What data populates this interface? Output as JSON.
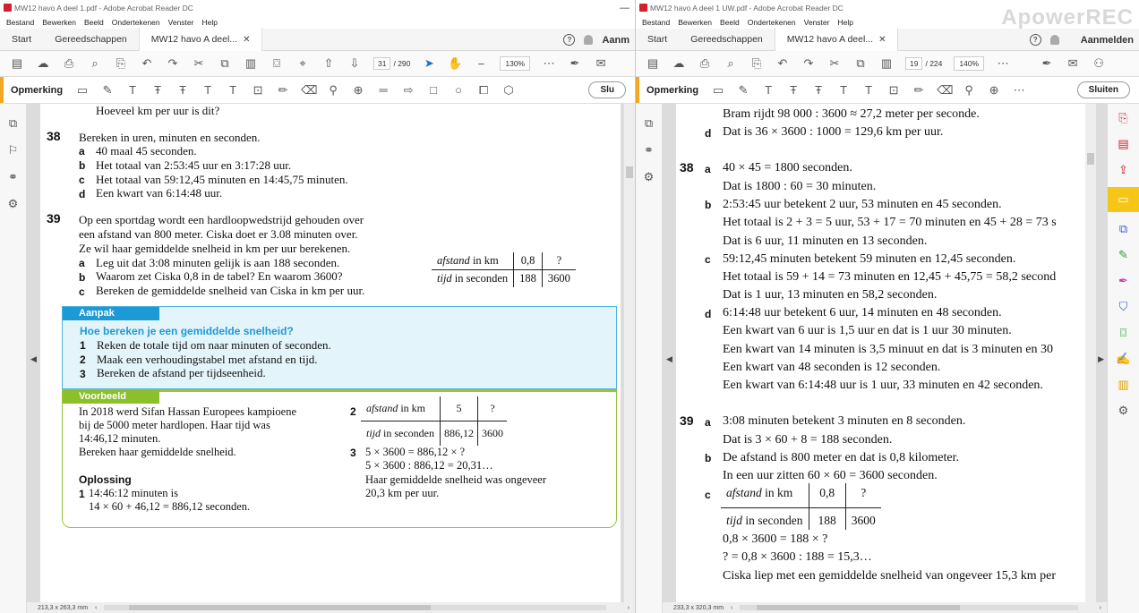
{
  "watermark": "ApowerREC",
  "left": {
    "title": "MW12 havo A deel 1.pdf - Adobe Acrobat Reader DC",
    "menu": [
      "Bestand",
      "Bewerken",
      "Beeld",
      "Ondertekenen",
      "Venster",
      "Help"
    ],
    "tabs": {
      "home": "Start",
      "tools": "Gereedschappen",
      "doc": "MW12 havo A deel..."
    },
    "signin": "Aanm",
    "page_current": "31",
    "page_total": "/ 290",
    "zoom": "130%",
    "anno_label": "Opmerking",
    "close_label": "Slu",
    "status_size": "213,3 x 263,3 mm",
    "page": {
      "top_line": "Hoeveel km per uur is dit?",
      "q38_num": "38",
      "q38_intro": "Bereken in uren, minuten en seconden.",
      "q38_a": "40 maal 45 seconden.",
      "q38_b": "Het totaal van 2:53:45 uur en 3:17:28 uur.",
      "q38_c": "Het totaal van 59:12,45 minuten en 14:45,75 minuten.",
      "q38_d": "Een kwart van 6:14:48 uur.",
      "q39_num": "39",
      "q39_l1": "Op een sportdag wordt een hardloopwedstrijd gehouden over",
      "q39_l2": "een afstand van 800 meter. Ciska doet er 3.08 minuten over.",
      "q39_l3": "Ze wil haar gemiddelde snelheid in km per uur berekenen.",
      "q39_a": "Leg uit dat 3:08 minuten gelijk is aan 188 seconden.",
      "q39_b": "Waarom zet Ciska 0,8 in de tabel? En waarom 3600?",
      "q39_c": "Bereken de gemiddelde snelheid van Ciska in km per uur.",
      "table1": {
        "r1_label_it": "afstand",
        "r1_label": " in km",
        "r1_v1": "0,8",
        "r1_v2": "?",
        "r2_label_it": "tijd",
        "r2_label": " in seconden",
        "r2_v1": "188",
        "r2_v2": "3600"
      },
      "aanpak": {
        "header": "Aanpak",
        "question": "Hoe bereken je een gemiddelde snelheid?",
        "s1": "Reken de totale tijd om naar minuten of seconden.",
        "s2": "Maak een verhoudingstabel met afstand en tijd.",
        "s3": "Bereken de afstand per tijdseenheid."
      },
      "voorbeeld": {
        "header": "Voorbeeld",
        "l1": "In 2018 werd Sifan Hassan Europees kampioene",
        "l2": "bij de 5000 meter hardlopen. Haar tijd was",
        "l3": "14:46,12 minuten.",
        "l4": "Bereken haar gemiddelde snelheid.",
        "oplossing": "Oplossing",
        "o1": "14:46:12 minuten is",
        "o2": "14 × 60 +  46,12 = 886,12 seconden.",
        "table2": {
          "r1_label_it": "afstand",
          "r1_label": " in km",
          "r1_v1": "5",
          "r1_v2": "?",
          "r2_label_it": "tijd",
          "r2_label": " in seconden",
          "r2_v1": "886,12",
          "r2_v2": "3600"
        },
        "s3a": "5 × 3600 = 886,12 × ?",
        "s3b": "5 × 3600 : 886,12 = 20,31…",
        "s3c": "Haar gemiddelde snelheid was ongeveer",
        "s3d": "20,3 km per uur."
      }
    }
  },
  "right": {
    "title": "MW12 havo A deel 1 UW.pdf - Adobe Acrobat Reader DC",
    "menu": [
      "Bestand",
      "Bewerken",
      "Beeld",
      "Ondertekenen",
      "Venster",
      "Help"
    ],
    "tabs": {
      "home": "Start",
      "tools": "Gereedschappen",
      "doc": "MW12 havo A deel..."
    },
    "signin": "Aanmelden",
    "page_current": "19",
    "page_total": "/ 224",
    "zoom": "140%",
    "anno_label": "Opmerking",
    "close_label": "Sluiten",
    "status_size": "233,3 x 320,3 mm",
    "page": {
      "l0": "Bram rijdt 98 000 : 3600 ≈ 27,2 meter per seconde.",
      "l1": "Dat is 36 × 3600 : 1000 = 129,6 km per uur.",
      "a38": "40 × 45 = 1800 seconden.",
      "a38b": "Dat is 1800 : 60 = 30 minuten.",
      "b38": "2:53:45 uur betekent 2 uur, 53 minuten en 45 seconden.",
      "b38b": "Het totaal is 2 + 3 = 5 uur, 53 + 17 = 70 minuten en 45 + 28 = 73 s",
      "b38c": "Dat is 6 uur, 11 minuten en 13 seconden.",
      "c38": "59:12,45 minuten betekent 59 minuten en 12,45 seconden.",
      "c38b": "Het totaal is 59 + 14 = 73 minuten en 12,45 + 45,75 = 58,2 second",
      "c38c": "Dat is 1 uur, 13 minuten en 58,2 seconden.",
      "d38": "6:14:48 uur betekent 6 uur, 14 minuten en 48 seconden.",
      "d38b": "Een kwart van 6 uur is 1,5 uur en dat is 1 uur 30 minuten.",
      "d38c": "Een kwart van 14 minuten is 3,5 minuut en dat is 3 minuten en 30",
      "d38d": "Een kwart van 48 seconden is 12 seconden.",
      "d38e": "Een kwart van 6:14:48 uur is 1 uur, 33 minuten en 42 seconden.",
      "a39": "3:08 minuten betekent 3 minuten en 8 seconden.",
      "a39b": "Dat is 3 × 60 + 8 = 188 seconden.",
      "b39": "De afstand is 800 meter en dat is 0,8 kilometer.",
      "b39b": "In een uur zitten 60 × 60 = 3600 seconden.",
      "table3": {
        "r1_label_it": "afstand",
        "r1_label": " in km",
        "r1_v1": "0,8",
        "r1_v2": "?",
        "r2_label_it": "tijd",
        "r2_label": " in seconden",
        "r2_v1": "188",
        "r2_v2": "3600"
      },
      "c39a": "0,8 × 3600 = 188 × ?",
      "c39b": "? = 0,8 × 3600 : 188 = 15,3…",
      "c39c": "Ciska liep met een gemiddelde snelheid van ongeveer 15,3 km per"
    }
  }
}
